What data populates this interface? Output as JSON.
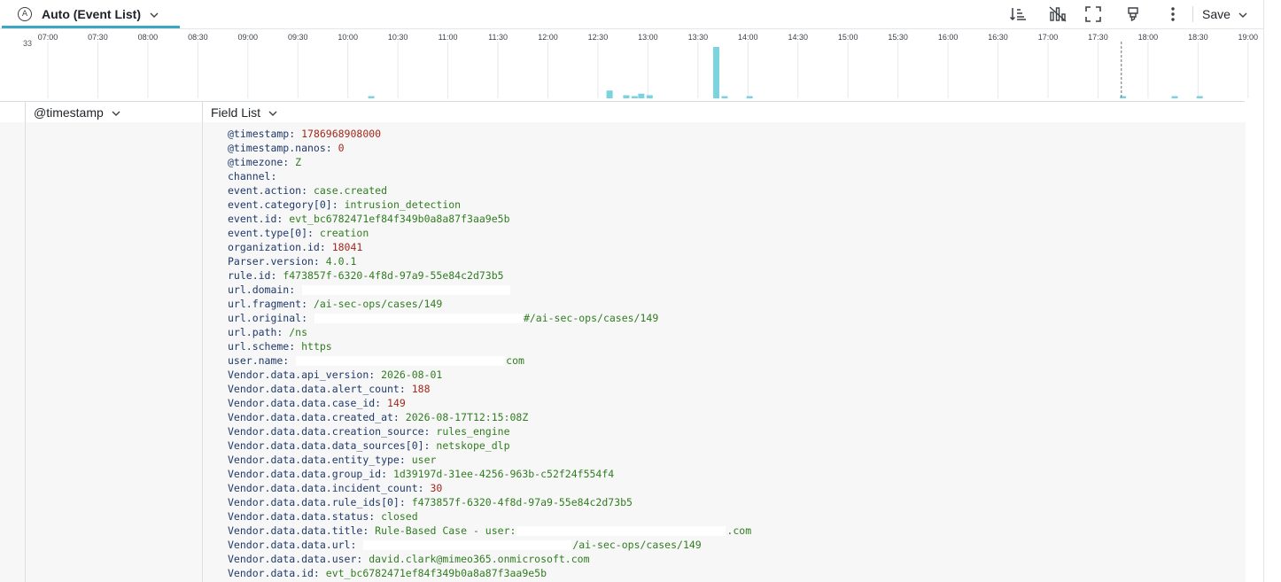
{
  "toolbar": {
    "auto_badge": "A",
    "view_title": "Auto (Event List)",
    "save_label": "Save",
    "icons": [
      "sort-order-icon",
      "chart-toggle-icon",
      "fullscreen-icon",
      "highlight-icon",
      "more-options-icon"
    ]
  },
  "timeline": {
    "max_count_label": "33",
    "accent_color": "#7cd3e0",
    "time_labels": [
      "07:00",
      "07:30",
      "08:00",
      "08:30",
      "09:00",
      "09:30",
      "10:00",
      "10:30",
      "11:00",
      "11:30",
      "12:00",
      "12:30",
      "13:00",
      "13:30",
      "14:00",
      "14:30",
      "15:00",
      "15:30",
      "16:00",
      "16:30",
      "17:00",
      "17:30",
      "18:00",
      "18:30",
      "19:00"
    ],
    "bars": [
      {
        "time": "10:14",
        "count": 1
      },
      {
        "time": "12:37",
        "count": 5
      },
      {
        "time": "12:47",
        "count": 2
      },
      {
        "time": "12:52",
        "count": 1
      },
      {
        "time": "12:56",
        "count": 3
      },
      {
        "time": "13:01",
        "count": 2
      },
      {
        "time": "13:41",
        "count": 33
      },
      {
        "time": "13:46",
        "count": 1
      },
      {
        "time": "14:01",
        "count": 1
      },
      {
        "time": "17:45",
        "count": 1
      },
      {
        "time": "18:16",
        "count": 1
      },
      {
        "time": "18:31",
        "count": 1
      }
    ],
    "marker_time": "17:44"
  },
  "columns": {
    "timestamp_label": "@timestamp",
    "fieldlist_label": "Field List"
  },
  "fields": [
    {
      "key": "@timestamp",
      "parts": [
        {
          "t": "1786968908000",
          "c": "fnum"
        }
      ]
    },
    {
      "key": "@timestamp.nanos",
      "parts": [
        {
          "t": "0",
          "c": "fnum"
        }
      ]
    },
    {
      "key": "@timezone",
      "parts": [
        {
          "t": "Z",
          "c": "fval"
        }
      ]
    },
    {
      "key": "channel",
      "parts": []
    },
    {
      "key": "event.action",
      "parts": [
        {
          "t": "case.created",
          "c": "fval"
        }
      ]
    },
    {
      "key": "event.category[0]",
      "parts": [
        {
          "t": "intrusion_detection",
          "c": "fval"
        }
      ]
    },
    {
      "key": "event.id",
      "parts": [
        {
          "t": "evt_bc6782471ef84f349b0a8a87f3aa9e5b",
          "c": "fval"
        }
      ]
    },
    {
      "key": "event.type[0]",
      "parts": [
        {
          "t": "creation",
          "c": "fval"
        }
      ]
    },
    {
      "key": "organization.id",
      "parts": [
        {
          "t": "18041",
          "c": "fnum"
        }
      ]
    },
    {
      "key": "Parser.version",
      "parts": [
        {
          "t": "4.0.1",
          "c": "fval"
        }
      ]
    },
    {
      "key": "rule.id",
      "parts": [
        {
          "t": "f473857f-6320-4f8d-97a9-55e84c2d73b5",
          "c": "fval"
        }
      ]
    },
    {
      "key": "url.domain",
      "parts": [
        {
          "redact": 235
        }
      ]
    },
    {
      "key": "url.fragment",
      "parts": [
        {
          "t": "/ai-sec-ops/cases/149",
          "c": "fval"
        }
      ]
    },
    {
      "key": "url.original",
      "parts": [
        {
          "redact": 235
        },
        {
          "t": "#/ai-sec-ops/cases/149",
          "c": "fval"
        }
      ]
    },
    {
      "key": "url.path",
      "parts": [
        {
          "t": "/ns",
          "c": "fval"
        }
      ]
    },
    {
      "key": "url.scheme",
      "parts": [
        {
          "t": "https",
          "c": "fval"
        }
      ]
    },
    {
      "key": "user.name",
      "parts": [
        {
          "redact": 236
        },
        {
          "t": "com",
          "c": "fval"
        }
      ]
    },
    {
      "key": "Vendor.data.api_version",
      "parts": [
        {
          "t": "2026-08-01",
          "c": "fval"
        }
      ]
    },
    {
      "key": "Vendor.data.data.alert_count",
      "parts": [
        {
          "t": "188",
          "c": "fnum"
        }
      ]
    },
    {
      "key": "Vendor.data.data.case_id",
      "parts": [
        {
          "t": "149",
          "c": "fnum"
        }
      ]
    },
    {
      "key": "Vendor.data.data.created_at",
      "parts": [
        {
          "t": "2026-08-17T12:15:08Z",
          "c": "fval"
        }
      ]
    },
    {
      "key": "Vendor.data.data.creation_source",
      "parts": [
        {
          "t": "rules_engine",
          "c": "fval"
        }
      ]
    },
    {
      "key": "Vendor.data.data.data_sources[0]",
      "parts": [
        {
          "t": "netskope_dlp",
          "c": "fval"
        }
      ]
    },
    {
      "key": "Vendor.data.data.entity_type",
      "parts": [
        {
          "t": "user",
          "c": "fval"
        }
      ]
    },
    {
      "key": "Vendor.data.data.group_id",
      "parts": [
        {
          "t": "1d39197d-31ee-4256-963b-c52f24f554f4",
          "c": "fval"
        }
      ]
    },
    {
      "key": "Vendor.data.data.incident_count",
      "parts": [
        {
          "t": "30",
          "c": "fnum"
        }
      ]
    },
    {
      "key": "Vendor.data.data.rule_ids[0]",
      "parts": [
        {
          "t": "f473857f-6320-4f8d-97a9-55e84c2d73b5",
          "c": "fval"
        }
      ]
    },
    {
      "key": "Vendor.data.data.status",
      "parts": [
        {
          "t": "closed",
          "c": "fval"
        }
      ]
    },
    {
      "key": "Vendor.data.data.title",
      "parts": [
        {
          "t": "Rule-Based Case - user:",
          "c": "fval"
        },
        {
          "redact": 236
        },
        {
          "t": ".com",
          "c": "fval"
        }
      ]
    },
    {
      "key": "Vendor.data.data.url",
      "parts": [
        {
          "redact": 235
        },
        {
          "t": "/ai-sec-ops/cases/149",
          "c": "fval"
        }
      ]
    },
    {
      "key": "Vendor.data.data.user",
      "parts": [
        {
          "t": "david.clark@mimeo365.onmicrosoft.com",
          "c": "fval"
        }
      ]
    },
    {
      "key": "Vendor.data.id",
      "parts": [
        {
          "t": "evt_bc6782471ef84f349b0a8a87f3aa9e5b",
          "c": "fval"
        }
      ]
    }
  ]
}
